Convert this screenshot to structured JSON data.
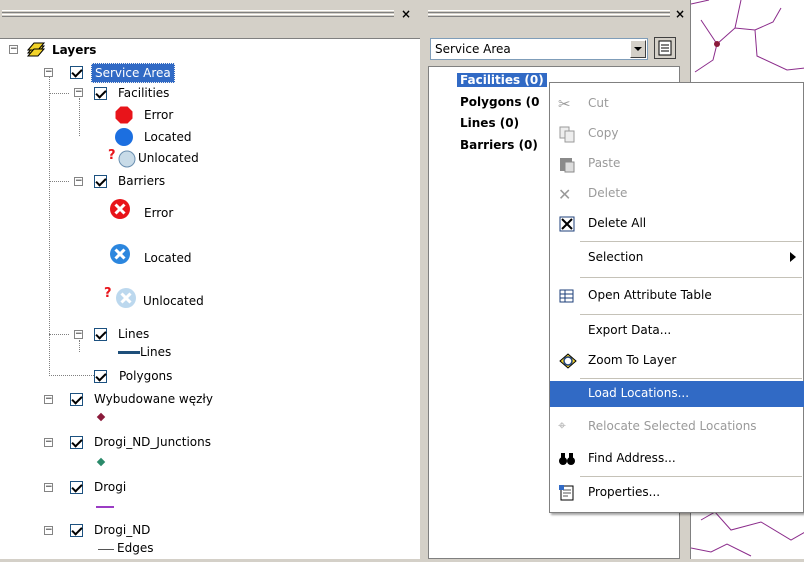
{
  "toc": {
    "root_label": "Layers",
    "service_area_label": "Service Area",
    "facilities_label": "Facilities",
    "facilities_items": [
      "Error",
      "Located",
      "Unlocated"
    ],
    "barriers_label": "Barriers",
    "barriers_items": [
      "Error",
      "Located",
      "Unlocated"
    ],
    "lines_group_label": "Lines",
    "lines_item_label": "Lines",
    "polygons_label": "Polygons",
    "layer_wybudowane": "Wybudowane węzły",
    "layer_junctions": "Drogi_ND_Junctions",
    "layer_drogi": "Drogi",
    "layer_drogi_nd": "Drogi_ND",
    "edges_label": "Edges"
  },
  "network_window": {
    "dropdown_value": "Service Area",
    "items": [
      "Facilities (0)",
      "Polygons (0",
      "Lines (0)",
      "Barriers (0)"
    ]
  },
  "context_menu": {
    "cut": "Cut",
    "copy": "Copy",
    "paste": "Paste",
    "delete": "Delete",
    "delete_all": "Delete All",
    "selection": "Selection",
    "open_attribute_table": "Open Attribute Table",
    "export_data": "Export Data...",
    "zoom_to_layer": "Zoom To Layer",
    "load_locations": "Load Locations...",
    "relocate_selected": "Relocate Selected Locations",
    "find_address": "Find Address...",
    "properties": "Properties..."
  },
  "colors": {
    "selection_blue": "#316ac5",
    "map_line": "#8b2c8b",
    "error_red": "#e8141a",
    "located_blue": "#1c6fe0"
  }
}
